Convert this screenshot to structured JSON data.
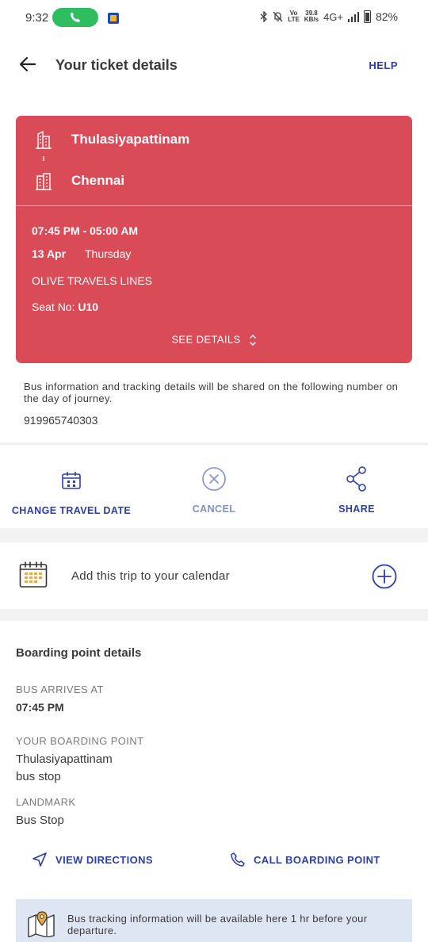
{
  "status_bar": {
    "time": "9:32",
    "net_speed_value": "39.8",
    "net_speed_unit": "KB/s",
    "volte_top": "Vo",
    "volte_bottom": "LTE",
    "network": "4G+",
    "battery": "82%"
  },
  "header": {
    "title": "Your ticket details",
    "help_label": "HELP"
  },
  "ticket": {
    "from_city": "Thulasiyapattinam",
    "to_city": "Chennai",
    "time_range": "07:45 PM - 05:00 AM",
    "date": "13 Apr",
    "day": "Thursday",
    "operator": "OLIVE TRAVELS LINES",
    "seat_label": "Seat No:",
    "seat_number": "U10",
    "see_details_label": "SEE DETAILS"
  },
  "contact": {
    "info_text": "Bus information and tracking details will be shared on the following number on the day of journey.",
    "phone": "919965740303"
  },
  "actions": {
    "change_date_label": "CHANGE TRAVEL DATE",
    "cancel_label": "CANCEL",
    "share_label": "SHARE"
  },
  "calendar": {
    "label": "Add this trip to your calendar"
  },
  "boarding": {
    "title": "Boarding point details",
    "arrives_label": "BUS ARRIVES AT",
    "arrives_value": "07:45 PM",
    "point_label": "YOUR BOARDING POINT",
    "point_line1": "Thulasiyapattinam",
    "point_line2": "bus stop",
    "landmark_label": "LANDMARK",
    "landmark_value": "Bus Stop",
    "directions_label": "VIEW DIRECTIONS",
    "call_label": "CALL BOARDING POINT"
  },
  "tracking": {
    "text": "Bus tracking information will be available here 1 hr before your departure."
  },
  "colors": {
    "ticket_red": "#d94b56",
    "link_blue": "#2c3ea8",
    "call_green": "#2fbd5f",
    "banner_blue": "#dfe6f3"
  }
}
